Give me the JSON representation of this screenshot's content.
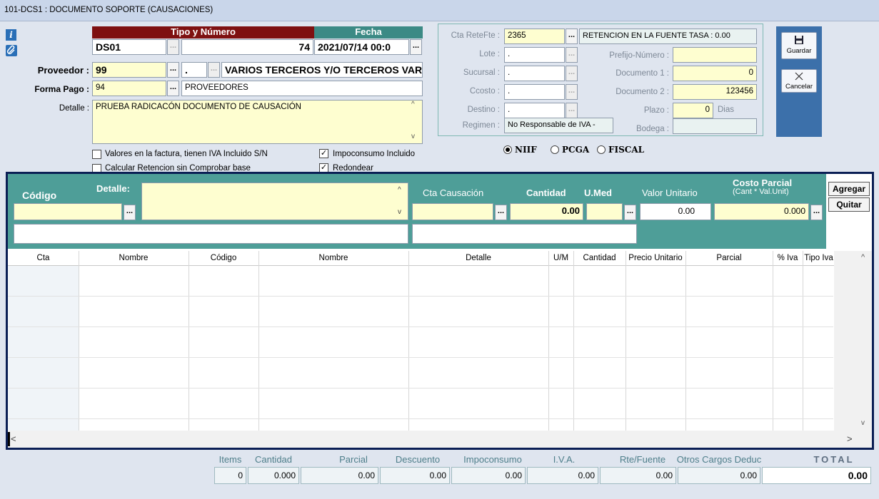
{
  "window": {
    "title": "101-DCS1 : DOCUMENTO SOPORTE (CAUSACIONES)"
  },
  "header": {
    "tipo_numero_label": "Tipo y Número",
    "fecha_label": "Fecha",
    "tipo": "DS01",
    "numero": "74",
    "fecha": "2021/07/14 00:0",
    "proveedor_label": "Proveedor :",
    "proveedor_code": "99",
    "proveedor_sub": ".",
    "proveedor_name": "VARIOS TERCEROS Y/O TERCEROS VAR",
    "forma_pago_label": "Forma Pago :",
    "forma_pago_code": "94",
    "forma_pago_name": "PROVEEDORES",
    "detalle_label": "Detalle :",
    "detalle_value": "PRUEBA RADICACÓN DOCUMENTO DE CAUSACIÓN"
  },
  "checkboxes": {
    "iva_incluido": {
      "label": "Valores en la factura, tienen  IVA Incluido S/N",
      "checked": false
    },
    "calc_retencion": {
      "label": "Calcular Retencion sin Comprobar base",
      "checked": false
    },
    "impoconsumo": {
      "label": "Impoconsumo Incluido",
      "checked": true
    },
    "redondear": {
      "label": "Redondear",
      "checked": true
    }
  },
  "right_panel": {
    "cta_retefte_label": "Cta ReteFte :",
    "cta_retefte": "2365",
    "retencion_text": "RETENCION EN LA FUENTE   TASA : 0.00",
    "lote_label": "Lote :",
    "lote": ".",
    "sucursal_label": "Sucursal :",
    "sucursal": ".",
    "ccosto_label": "Ccosto :",
    "ccosto": ".",
    "destino_label": "Destino :",
    "destino": ".",
    "regimen_label": "Regimen :",
    "regimen": "No Responsable de IVA -",
    "prefijo_label": "Prefijo-Número :",
    "prefijo": "",
    "doc1_label": "Documento 1 :",
    "doc1": "0",
    "doc2_label": "Documento 2 :",
    "doc2": "123456",
    "plazo_label": "Plazo :",
    "plazo": "0",
    "plazo_unit": "Dias",
    "bodega_label": "Bodega :",
    "bodega": ""
  },
  "radios": {
    "niif": "NIIF",
    "pcga": "PCGA",
    "fiscal": "FISCAL",
    "selected": "NIIF"
  },
  "toolbar": {
    "guardar": "Guardar",
    "cancelar": "Cancelar"
  },
  "entry": {
    "codigo_label": "Código",
    "detalle_label": "Detalle:",
    "cta_causacion_label": "Cta Causación",
    "cantidad_label": "Cantidad",
    "umed_label": "U.Med",
    "valor_unitario_label": "Valor Unitario",
    "costo_parcial_label": "Costo Parcial",
    "costo_parcial_sub": "(Cant * Val.Unit)",
    "codigo": "",
    "detalle": "",
    "cta_causacion": "",
    "cantidad": "0.00",
    "umed": "",
    "valor_unitario": "0.00",
    "costo_parcial": "0.000",
    "agregar": "Agregar",
    "quitar": "Quitar"
  },
  "grid": {
    "columns": [
      "Cta",
      "Nombre",
      "Código",
      "Nombre",
      "Detalle",
      "U/M",
      "Cantidad",
      "Precio Unitario",
      "Parcial",
      "% Iva",
      "Tipo Iva"
    ],
    "rows": []
  },
  "totals": {
    "labels": [
      "Items",
      "Cantidad",
      "Parcial",
      "Descuento",
      "Impoconsumo",
      "I.V.A.",
      "Rte/Fuente",
      "Otros Cargos Deduc",
      "TOTAL"
    ],
    "values": [
      "0",
      "0.000",
      "0.00",
      "0.00",
      "0.00",
      "0.00",
      "0.00",
      "0.00",
      "0.00"
    ]
  }
}
